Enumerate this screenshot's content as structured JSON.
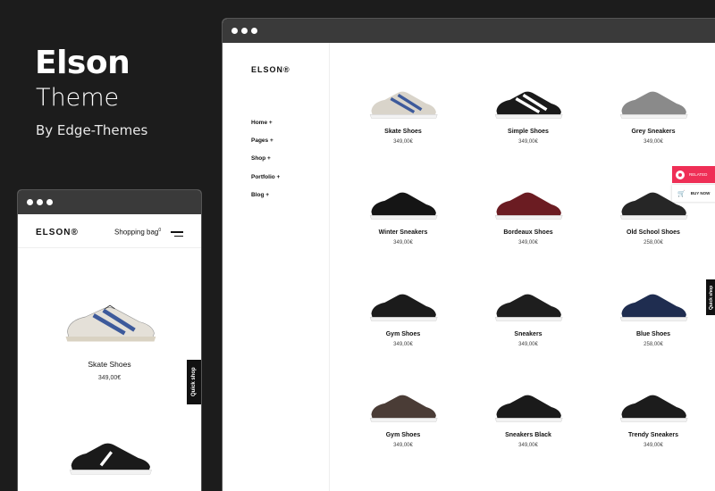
{
  "promo": {
    "title": "Elson",
    "subtitle": "Theme",
    "by": "By Edge-Themes"
  },
  "desktop": {
    "logo": "ELSON®",
    "nav": [
      "Home +",
      "Pages +",
      "Shop +",
      "Portfolio +",
      "Blog +"
    ],
    "products": [
      {
        "name": "Skate Shoes",
        "price": "349,00€",
        "color": "#d9d4ca",
        "accent": "#3d5a9b"
      },
      {
        "name": "Simple Shoes",
        "price": "349,00€",
        "color": "#1a1a1a",
        "accent": "#ffffff"
      },
      {
        "name": "Grey Sneakers",
        "price": "349,00€",
        "color": "#8a8a8a",
        "accent": "#8a8a8a"
      },
      {
        "name": "Winter Sneakers",
        "price": "349,00€",
        "color": "#151515",
        "accent": "#151515"
      },
      {
        "name": "Bordeaux Shoes",
        "price": "349,00€",
        "color": "#6b1c22",
        "accent": "#6b1c22"
      },
      {
        "name": "Old School Shoes",
        "price": "258,00€",
        "color": "#262626",
        "accent": "#262626"
      },
      {
        "name": "Gym Shoes",
        "price": "349,00€",
        "color": "#1b1b1b",
        "accent": "#1b1b1b"
      },
      {
        "name": "Sneakers",
        "price": "349,00€",
        "color": "#1e1e1e",
        "accent": "#1e1e1e"
      },
      {
        "name": "Blue Shoes",
        "price": "258,00€",
        "color": "#1f2d50",
        "accent": "#1f2d50"
      },
      {
        "name": "Gym Shoes",
        "price": "349,00€",
        "color": "#4a3c36",
        "accent": "#4a3c36"
      },
      {
        "name": "Sneakers Black",
        "price": "349,00€",
        "color": "#1a1a1a",
        "accent": "#1a1a1a"
      },
      {
        "name": "Trendy Sneakers",
        "price": "349,00€",
        "color": "#1c1c1c",
        "accent": "#1c1c1c"
      }
    ],
    "related_label": "RELATED",
    "buynow_label": "BUY NOW",
    "quickshop_label": "Quick shop"
  },
  "mobile": {
    "logo": "ELSON®",
    "bag_label": "Shopping bag",
    "bag_count": "0",
    "products": [
      {
        "name": "Skate Shoes",
        "price": "349,00€"
      }
    ],
    "quickshop_label": "Quick shop"
  },
  "colors": {
    "background": "#1c1c1c",
    "accent": "#ef2f56"
  }
}
